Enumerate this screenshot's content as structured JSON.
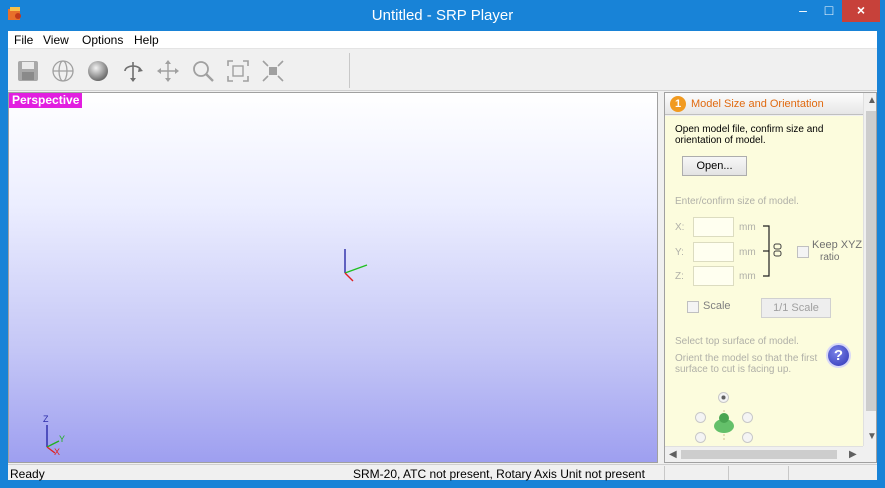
{
  "window": {
    "title": "Untitled - SRP Player",
    "accent": "#1883d7"
  },
  "controls": {
    "minimize": "‒",
    "maximize": "□",
    "close": "×"
  },
  "menu": [
    "File",
    "View",
    "Options",
    "Help"
  ],
  "toolbar": [
    "save-icon",
    "globe-icon",
    "sphere-icon",
    "rotate-icon",
    "pan-icon",
    "zoom-icon",
    "fit-icon",
    "shrink-icon"
  ],
  "viewport": {
    "label": "Perspective",
    "label_color": "#e21ee0",
    "axis_z": "Z",
    "axis_y": "Y",
    "axis_x": "X"
  },
  "panel": {
    "step": "1",
    "title": "Model Size and Orientation",
    "intro_1": "Open model file, confirm size and",
    "intro_2": "orientation of model.",
    "open_button": "Open...",
    "size_prompt": "Enter/confirm size of model.",
    "x_label": "X:",
    "y_label": "Y:",
    "z_label": "Z:",
    "unit": "mm",
    "keep_ratio_1": "Keep XYZ",
    "keep_ratio_2": "ratio",
    "scale_label": "Scale",
    "full_scale_button": "1/1 Scale",
    "surface_prompt": "Select top surface of model.",
    "orient_1": "Orient the model so that the first",
    "orient_2": "surface to cut is facing up.",
    "help": "?"
  },
  "status": {
    "left": "Ready",
    "middle": "SRM-20, ATC not present, Rotary Axis Unit not present"
  }
}
